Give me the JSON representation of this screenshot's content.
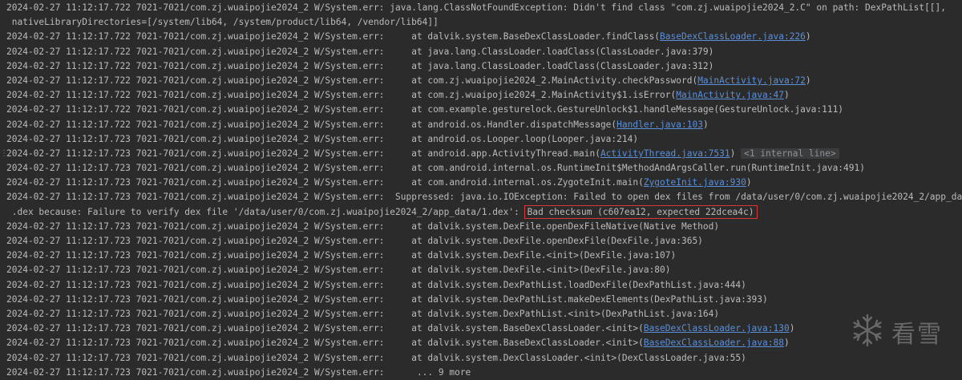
{
  "log": {
    "lines": [
      {
        "ts": "2024-02-27 11:12:17.722",
        "tag": "7021-7021/com.zj.wuaipojie2024_2 W/System.err:",
        "pad": " ",
        "pre": "java.lang.ClassNotFoundException: Didn't find class \"com.zj.wuaipojie2024_2.C\" on path: DexPathList[[],",
        "link": "",
        "post": ""
      },
      {
        "cont": " nativeLibraryDirectories=[/system/lib64, /system/product/lib64, /vendor/lib64]]"
      },
      {
        "ts": "2024-02-27 11:12:17.722",
        "tag": "7021-7021/com.zj.wuaipojie2024_2 W/System.err:",
        "pad": "     ",
        "pre": "at dalvik.system.BaseDexClassLoader.findClass(",
        "link": "BaseDexClassLoader.java:226",
        "post": ")"
      },
      {
        "ts": "2024-02-27 11:12:17.722",
        "tag": "7021-7021/com.zj.wuaipojie2024_2 W/System.err:",
        "pad": "     ",
        "pre": "at java.lang.ClassLoader.loadClass(ClassLoader.java:379)",
        "link": "",
        "post": ""
      },
      {
        "ts": "2024-02-27 11:12:17.722",
        "tag": "7021-7021/com.zj.wuaipojie2024_2 W/System.err:",
        "pad": "     ",
        "pre": "at java.lang.ClassLoader.loadClass(ClassLoader.java:312)",
        "link": "",
        "post": ""
      },
      {
        "ts": "2024-02-27 11:12:17.722",
        "tag": "7021-7021/com.zj.wuaipojie2024_2 W/System.err:",
        "pad": "     ",
        "pre": "at com.zj.wuaipojie2024_2.MainActivity.checkPassword(",
        "link": "MainActivity.java:72",
        "post": ")"
      },
      {
        "ts": "2024-02-27 11:12:17.722",
        "tag": "7021-7021/com.zj.wuaipojie2024_2 W/System.err:",
        "pad": "     ",
        "pre": "at com.zj.wuaipojie2024_2.MainActivity$1.isError(",
        "link": "MainActivity.java:47",
        "post": ")"
      },
      {
        "ts": "2024-02-27 11:12:17.722",
        "tag": "7021-7021/com.zj.wuaipojie2024_2 W/System.err:",
        "pad": "     ",
        "pre": "at com.example.gesturelock.GestureUnlock$1.handleMessage(GestureUnlock.java:111)",
        "link": "",
        "post": ""
      },
      {
        "ts": "2024-02-27 11:12:17.722",
        "tag": "7021-7021/com.zj.wuaipojie2024_2 W/System.err:",
        "pad": "     ",
        "pre": "at android.os.Handler.dispatchMessage(",
        "link": "Handler.java:103",
        "post": ")"
      },
      {
        "ts": "2024-02-27 11:12:17.723",
        "tag": "7021-7021/com.zj.wuaipojie2024_2 W/System.err:",
        "pad": "     ",
        "pre": "at android.os.Looper.loop(Looper.java:214)",
        "link": "",
        "post": ""
      },
      {
        "ts": "2024-02-27 11:12:17.723",
        "tag": "7021-7021/com.zj.wuaipojie2024_2 W/System.err:",
        "pad": "     ",
        "pre": "at android.app.ActivityThread.main(",
        "link": "ActivityThread.java:7531",
        "post": ")",
        "fold": "<1 internal line>"
      },
      {
        "ts": "2024-02-27 11:12:17.723",
        "tag": "7021-7021/com.zj.wuaipojie2024_2 W/System.err:",
        "pad": "     ",
        "pre": "at com.android.internal.os.RuntimeInit$MethodAndArgsCaller.run(RuntimeInit.java:491)",
        "link": "",
        "post": ""
      },
      {
        "ts": "2024-02-27 11:12:17.723",
        "tag": "7021-7021/com.zj.wuaipojie2024_2 W/System.err:",
        "pad": "     ",
        "pre": "at com.android.internal.os.ZygoteInit.main(",
        "link": "ZygoteInit.java:930",
        "post": ")"
      },
      {
        "ts": "2024-02-27 11:12:17.723",
        "tag": "7021-7021/com.zj.wuaipojie2024_2 W/System.err:",
        "pad": "  ",
        "pre": "Suppressed: java.io.IOException: Failed to open dex files from /data/user/0/com.zj.wuaipojie2024_2/app_data",
        "link": "",
        "post": ""
      },
      {
        "cont": " .dex because: Failure to verify dex file '/data/user/0/com.zj.wuaipojie2024_2/app_data/1.dex': ",
        "highlight": "Bad checksum (c607ea12, expected 22dcea4c)"
      },
      {
        "ts": "2024-02-27 11:12:17.723",
        "tag": "7021-7021/com.zj.wuaipojie2024_2 W/System.err:",
        "pad": "     ",
        "pre": "at dalvik.system.DexFile.openDexFileNative(Native Method)",
        "link": "",
        "post": ""
      },
      {
        "ts": "2024-02-27 11:12:17.723",
        "tag": "7021-7021/com.zj.wuaipojie2024_2 W/System.err:",
        "pad": "     ",
        "pre": "at dalvik.system.DexFile.openDexFile(DexFile.java:365)",
        "link": "",
        "post": ""
      },
      {
        "ts": "2024-02-27 11:12:17.723",
        "tag": "7021-7021/com.zj.wuaipojie2024_2 W/System.err:",
        "pad": "     ",
        "pre": "at dalvik.system.DexFile.<init>(DexFile.java:107)",
        "link": "",
        "post": ""
      },
      {
        "ts": "2024-02-27 11:12:17.723",
        "tag": "7021-7021/com.zj.wuaipojie2024_2 W/System.err:",
        "pad": "     ",
        "pre": "at dalvik.system.DexFile.<init>(DexFile.java:80)",
        "link": "",
        "post": ""
      },
      {
        "ts": "2024-02-27 11:12:17.723",
        "tag": "7021-7021/com.zj.wuaipojie2024_2 W/System.err:",
        "pad": "     ",
        "pre": "at dalvik.system.DexPathList.loadDexFile(DexPathList.java:444)",
        "link": "",
        "post": ""
      },
      {
        "ts": "2024-02-27 11:12:17.723",
        "tag": "7021-7021/com.zj.wuaipojie2024_2 W/System.err:",
        "pad": "     ",
        "pre": "at dalvik.system.DexPathList.makeDexElements(DexPathList.java:393)",
        "link": "",
        "post": ""
      },
      {
        "ts": "2024-02-27 11:12:17.723",
        "tag": "7021-7021/com.zj.wuaipojie2024_2 W/System.err:",
        "pad": "     ",
        "pre": "at dalvik.system.DexPathList.<init>(DexPathList.java:164)",
        "link": "",
        "post": ""
      },
      {
        "ts": "2024-02-27 11:12:17.723",
        "tag": "7021-7021/com.zj.wuaipojie2024_2 W/System.err:",
        "pad": "     ",
        "pre": "at dalvik.system.BaseDexClassLoader.<init>(",
        "link": "BaseDexClassLoader.java:130",
        "post": ")"
      },
      {
        "ts": "2024-02-27 11:12:17.723",
        "tag": "7021-7021/com.zj.wuaipojie2024_2 W/System.err:",
        "pad": "     ",
        "pre": "at dalvik.system.BaseDexClassLoader.<init>(",
        "link": "BaseDexClassLoader.java:88",
        "post": ")"
      },
      {
        "ts": "2024-02-27 11:12:17.723",
        "tag": "7021-7021/com.zj.wuaipojie2024_2 W/System.err:",
        "pad": "     ",
        "pre": "at dalvik.system.DexClassLoader.<init>(DexClassLoader.java:55)",
        "link": "",
        "post": ""
      },
      {
        "ts": "2024-02-27 11:12:17.723",
        "tag": "7021-7021/com.zj.wuaipojie2024_2 W/System.err:",
        "pad": "      ",
        "pre": "... 9 more",
        "link": "",
        "post": ""
      }
    ]
  },
  "watermark": {
    "icon": "snowflake-icon",
    "text": "看雪"
  },
  "colors": {
    "background": "#2b2b2b",
    "text": "#bbbbbb",
    "link": "#5b8fd8",
    "highlight_border": "#d9383a"
  }
}
